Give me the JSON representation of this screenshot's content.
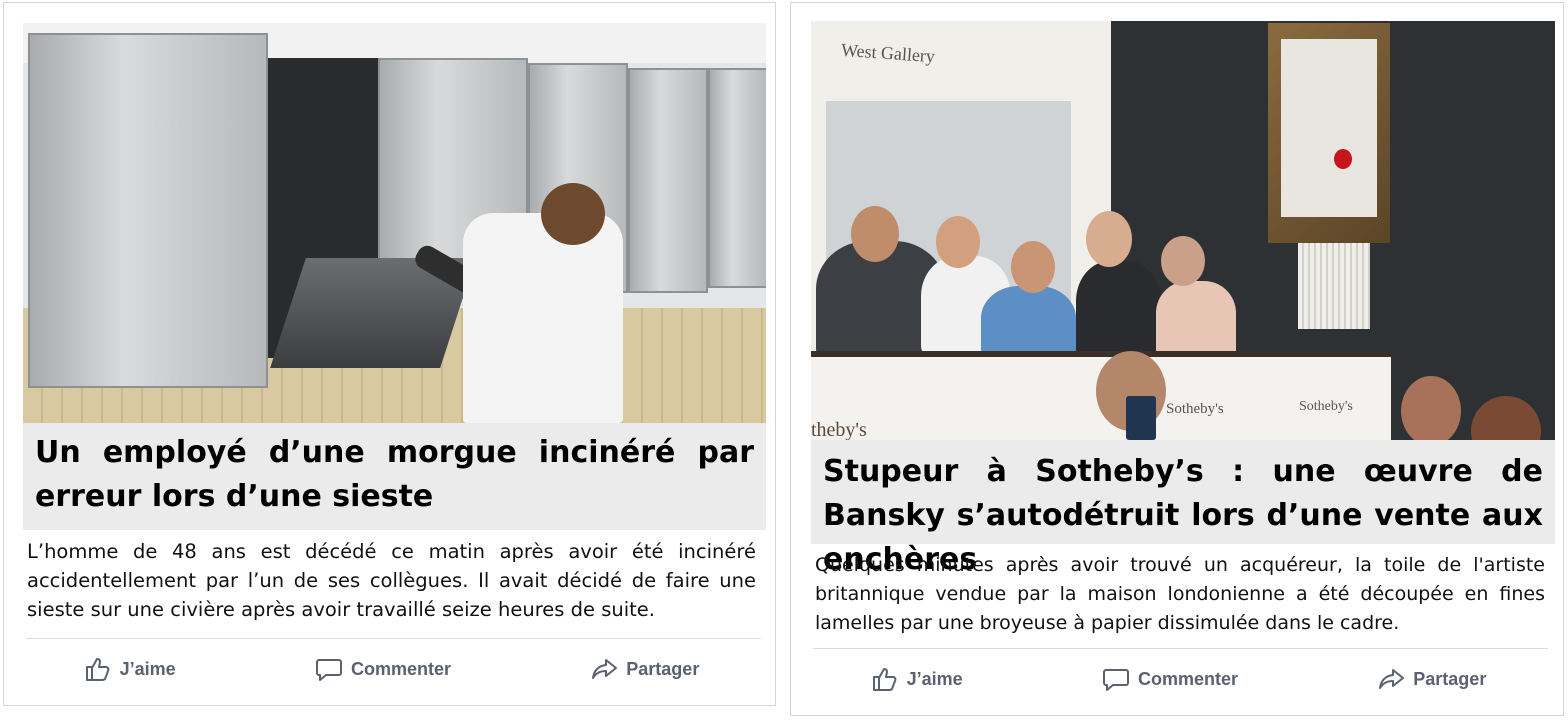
{
  "posts": [
    {
      "headline": "Un employé d’une morgue incinéré par erreur lors d’une sieste",
      "summary": "L’homme de 48 ans est décédé ce matin après avoir été incinéré accidentellement par l’un de ses collègues. Il avait décidé de faire une sieste sur une civière après avoir travaillé seize heures de suite.",
      "actions": {
        "like": "J’aime",
        "comment": "Commenter",
        "share": "Partager"
      }
    },
    {
      "headline": "Stupeur à Sotheby’s : une œuvre de Bansky s’autodétruit lors d’une vente aux enchères",
      "summary": "Quelques minutes après avoir trouvé un acquéreur, la toile de l'artiste britannique vendue par la maison londonienne a été découpée en fines lamelles par une broyeuse à papier dissimulée dans le cadre.",
      "photo_text": {
        "gallery_sign": "West Gallery",
        "desk_logo_1": "Sotheby's",
        "desk_logo_2": "Sotheby's",
        "desk_logo_3": "theby's"
      },
      "actions": {
        "like": "J’aime",
        "comment": "Commenter",
        "share": "Partager"
      }
    }
  ],
  "icons": {
    "like": "thumbs-up-icon",
    "comment": "speech-bubble-icon",
    "share": "share-arrow-icon"
  },
  "colors": {
    "headline_bg": "#ebebeb",
    "action_text": "#5a6270"
  }
}
